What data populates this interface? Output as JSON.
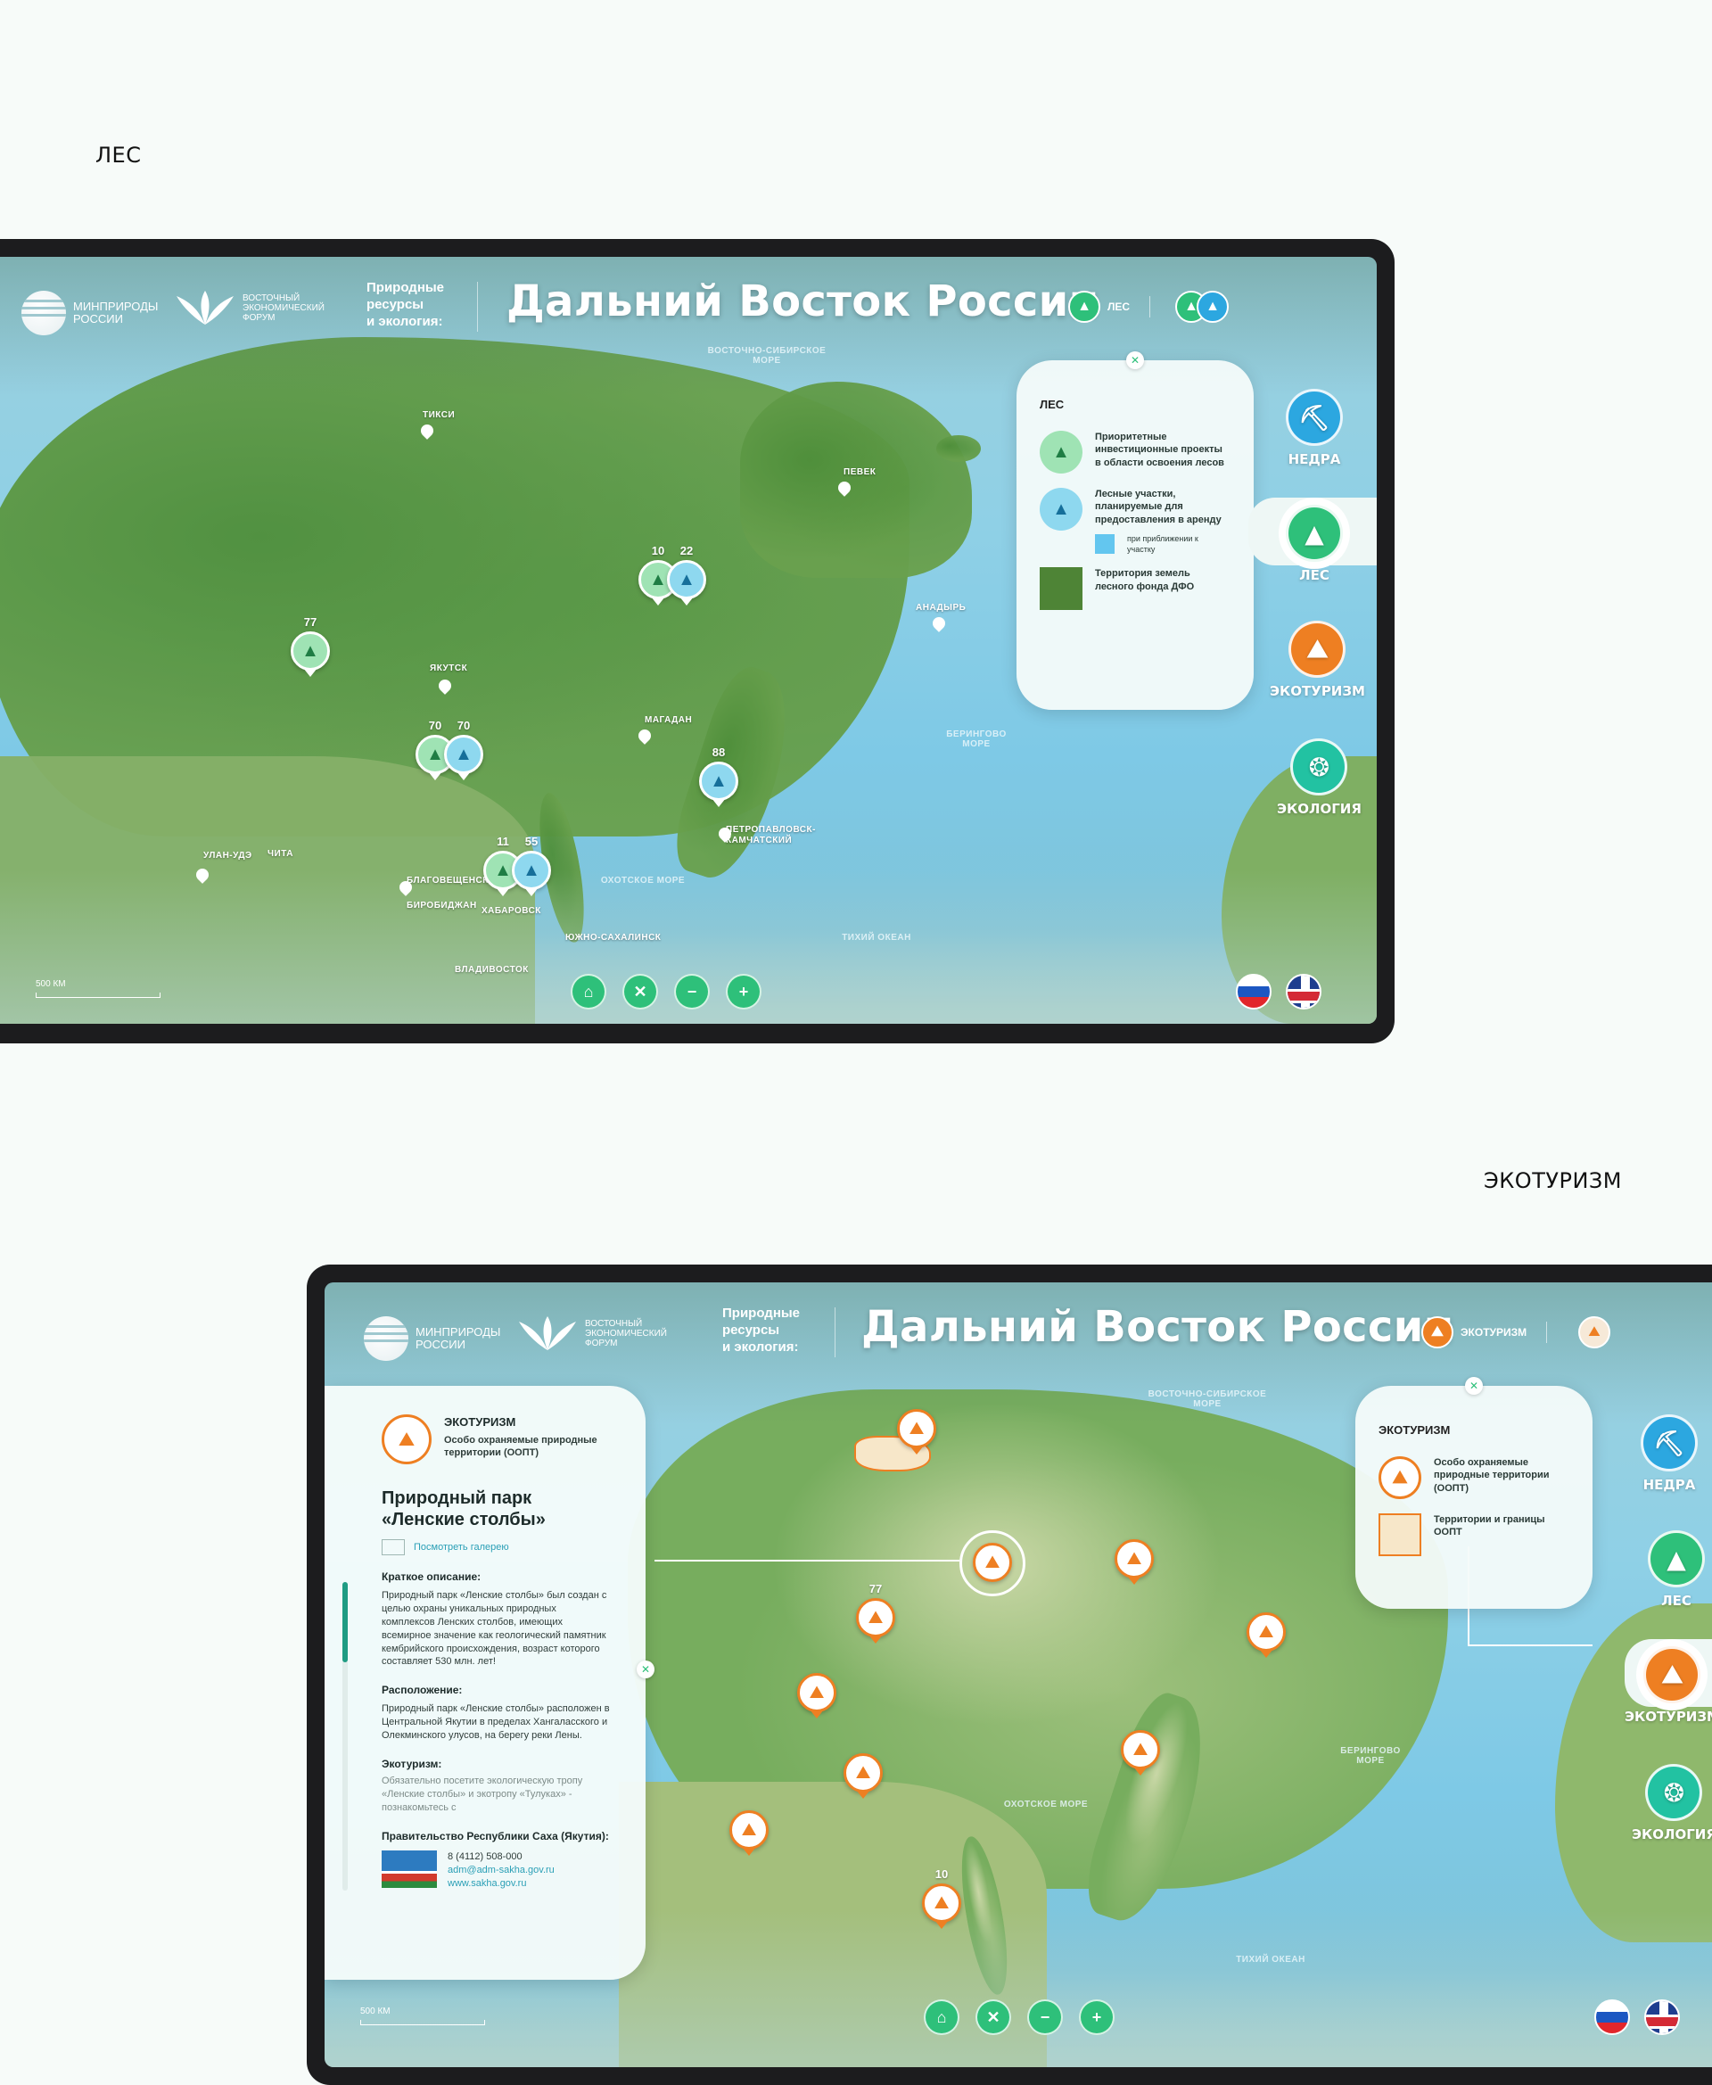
{
  "sections": {
    "forest_label": "ЛЕС",
    "eco_label": "ЭКОТУРИЗМ"
  },
  "header": {
    "logo_ministry": [
      "МИНПРИРОДЫ",
      "РОССИИ"
    ],
    "logo_forum": [
      "ВОСТОЧНЫЙ",
      "ЭКОНОМИЧЕСКИЙ",
      "ФОРУМ"
    ],
    "eco_caption": [
      "Природные",
      "ресурсы",
      "и экология:"
    ],
    "title": "Дальний Восток России"
  },
  "forest": {
    "chip_label": "ЛЕС",
    "legend": {
      "title": "ЛЕС",
      "items": [
        "Приоритетные инвестиционные проекты в области освоения лесов",
        "Лесные участки, планируемые для предоставления в аренду",
        "при приближении к участку",
        "Территория земель лесного фонда ДФО"
      ]
    },
    "pins": [
      {
        "num": "77",
        "kind": "g"
      },
      {
        "num": "10",
        "kind": "g"
      },
      {
        "num": "22",
        "kind": "b"
      },
      {
        "num": "70",
        "kind": "g"
      },
      {
        "num": "70",
        "kind": "b"
      },
      {
        "num": "88",
        "kind": "b"
      },
      {
        "num": "11",
        "kind": "g"
      },
      {
        "num": "55",
        "kind": "b"
      }
    ],
    "cities": [
      "ТИКСИ",
      "ПЕВЕК",
      "АНАДЫРЬ",
      "ЯКУТСК",
      "МАГАДАН",
      "ПЕТРОПАВЛОВСК-КАМЧАТСКИЙ",
      "БЛАГОВЕЩЕНСК",
      "БИРОБИДЖАН",
      "ХАБАРОВСК",
      "УЛАН-УДЭ",
      "ЧИТА",
      "ЮЖНО-САХАЛИНСК",
      "ВЛАДИВОСТОК"
    ],
    "seas": [
      "ВОСТОЧНО-СИБИРСКОЕ МОРЕ",
      "БЕРИНГОВО МОРЕ",
      "ОХОТСКОЕ МОРЕ",
      "ТИХИЙ ОКЕАН"
    ]
  },
  "eco": {
    "chip_label": "ЭКОТУРИЗМ",
    "legend": {
      "title": "ЭКОТУРИЗМ",
      "items": [
        "Особо охраняемые природные территории (ООПТ)",
        "Территории и границы ООПТ"
      ]
    },
    "panel": {
      "category": "ЭКОТУРИЗМ",
      "subtitle": "Особо охраняемые природные территории (ООПТ)",
      "park_title": "Природный парк «Ленские столбы»",
      "gallery_link": "Посмотреть галерею",
      "brief_h": "Краткое описание:",
      "brief": "Природный парк «Ленские столбы» был создан с целью охраны уникальных природных комплексов Ленских столбов, имеющих всемирное значение как геологический памятник кембрийского происхождения, возраст которого составляет 530 млн. лет!",
      "location_h": "Расположение:",
      "location": "Природный парк «Ленские столбы» расположен в Центральной Якутии в пределах Хангаласского и Олекминского улусов, на берегу реки Лены.",
      "eco_h": "Экотуризм:",
      "eco_text": "Обязательно посетите экологическую тропу «Ленские столбы» и экотропу «Тулуках» - познакомьтесь с",
      "gov_h": "Правительство Республики Саха (Якутия):",
      "phone": "8 (4112) 508-000",
      "email": "adm@adm-sakha.gov.ru",
      "site": "www.sakha.gov.ru"
    },
    "pins": [
      {
        "num": "77"
      },
      {
        "num": "10"
      }
    ],
    "seas": [
      "ВОСТОЧНО-СИБИРСКОЕ МОРЕ",
      "БЕРИНГОВО МОРЕ",
      "ОХОТСКОЕ МОРЕ",
      "ТИХИЙ ОКЕАН"
    ]
  },
  "categories": [
    "НЕДРА",
    "ЛЕС",
    "ЭКОТУРИЗМ",
    "ЭКОЛОГИЯ"
  ],
  "controls": {
    "home": "⌂",
    "reset": "✕",
    "minus": "−",
    "plus": "+"
  },
  "scale": "500 КМ",
  "colors": {
    "forest": "#2ec07a",
    "water_plot": "#2ca7e0",
    "eco": "#ee7f22",
    "ecology": "#22c2a2"
  }
}
